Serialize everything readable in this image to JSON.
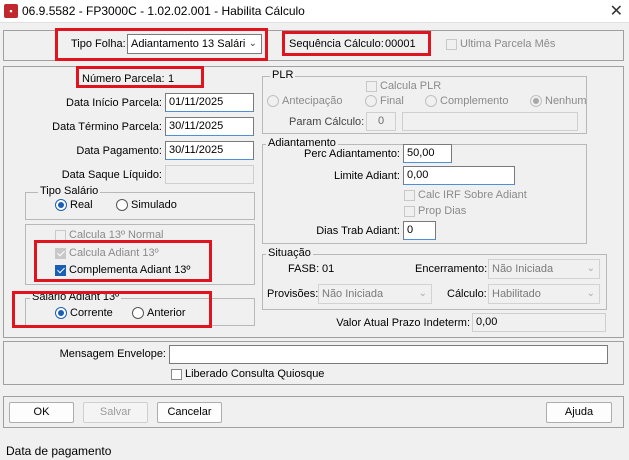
{
  "window": {
    "title": "06.9.5582 - FP3000C - 1.02.02.001 - Habilita Cálculo",
    "icon": "app-icon",
    "close": "✕"
  },
  "header": {
    "tipo_folha_label": "Tipo Folha:",
    "tipo_folha_value": "Adiantamento 13 Salári",
    "sequencia_label": "Sequência Cálculo:",
    "sequencia_value": "00001",
    "ultima_parcela_label": "Ultima Parcela Mês"
  },
  "left": {
    "numero_parcela_label": "Número Parcela:",
    "numero_parcela_value": "1",
    "data_inicio_label": "Data Início Parcela:",
    "data_inicio_value": "01/11/2025",
    "data_termino_label": "Data Término Parcela:",
    "data_termino_value": "30/11/2025",
    "data_pagamento_label": "Data Pagamento:",
    "data_pagamento_value": "30/11/2025",
    "data_saque_label": "Data Saque Líquido:",
    "data_saque_value": ""
  },
  "tipo_salario": {
    "legend": "Tipo Salário",
    "real": "Real",
    "simulado": "Simulado",
    "selected": "real"
  },
  "calculos": {
    "calcula_13_normal": "Calcula 13º Normal",
    "calcula_adiant_13": "Calcula Adiant 13º",
    "complementa_adiant_13": "Complementa Adiant 13º"
  },
  "salario_adiant": {
    "legend": "Salário Adiant 13º",
    "corrente": "Corrente",
    "anterior": "Anterior",
    "selected": "corrente"
  },
  "plr": {
    "legend": "PLR",
    "calcula_plr": "Calcula PLR",
    "antecipacao": "Antecipação",
    "final": "Final",
    "complemento": "Complemento",
    "nenhum": "Nenhum",
    "param_calculo_label": "Param Cálculo:",
    "param_calculo_value": "0",
    "param_calculo_desc": ""
  },
  "adiantamento": {
    "legend": "Adiantamento",
    "perc_label": "Perc Adiantamento:",
    "perc_value": "50,00",
    "limite_label": "Limite Adiant:",
    "limite_value": "0,00",
    "calc_irf_label": "Calc IRF Sobre Adiant",
    "prop_dias_label": "Prop Dias",
    "dias_trab_label": "Dias Trab Adiant:",
    "dias_trab_value": "0"
  },
  "situacao": {
    "legend": "Situação",
    "fasb_label": "FASB:",
    "fasb_value": "01",
    "encerramento_label": "Encerramento:",
    "encerramento_value": "Não Iniciada",
    "provisoes_label": "Provisões:",
    "provisoes_value": "Não Iniciada",
    "calculo_label": "Cálculo:",
    "calculo_value": "Habilitado",
    "valor_atual_label": "Valor Atual Prazo Indeterm:",
    "valor_atual_value": "0,00"
  },
  "envelope": {
    "mensagem_label": "Mensagem Envelope:",
    "mensagem_value": "",
    "liberado_label": "Liberado Consulta Quiosque"
  },
  "buttons": {
    "ok": "OK",
    "salvar": "Salvar",
    "cancelar": "Cancelar",
    "ajuda": "Ajuda"
  },
  "status": {
    "text": "Data de pagamento"
  },
  "colors": {
    "highlight": "#e0141e",
    "accent": "#1a5fb4"
  }
}
